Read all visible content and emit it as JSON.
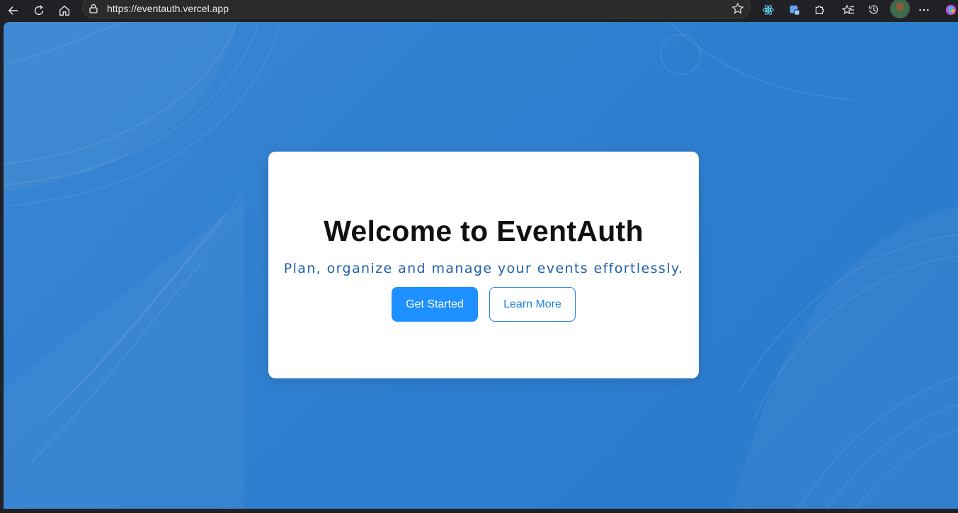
{
  "browser": {
    "url": "https://eventauth.vercel.app"
  },
  "page": {
    "title": "Welcome to EventAuth",
    "subtitle": "Plan, organize and manage your events effortlessly.",
    "primary_button": "Get Started",
    "secondary_button": "Learn More"
  },
  "colors": {
    "background": "#2f7fd0",
    "primary": "#1e90ff",
    "subtitle": "#1f5fa8"
  },
  "icons": [
    "back-icon",
    "refresh-icon",
    "home-icon",
    "lock-icon",
    "star-icon",
    "react-devtools-icon",
    "extension-icon",
    "puzzle-icon",
    "favorites-icon",
    "history-icon",
    "more-icon",
    "copilot-icon"
  ]
}
